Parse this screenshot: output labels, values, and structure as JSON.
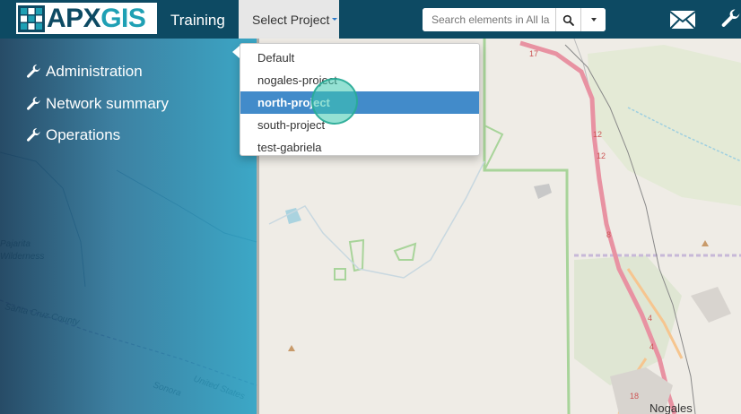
{
  "app": {
    "logo_text_apx": "APX",
    "logo_text_gis": "GIS",
    "brand_title": "Training"
  },
  "navbar": {
    "project_selector_label": "Select Project",
    "search_placeholder": "Search elements in All la",
    "icons": [
      "search-icon",
      "caret-down-icon",
      "mail-icon",
      "wrench-icon"
    ]
  },
  "sidebar": {
    "items": [
      {
        "label": "Administration",
        "icon": "wrench-icon"
      },
      {
        "label": "Network summary",
        "icon": "wrench-icon"
      },
      {
        "label": "Operations",
        "icon": "wrench-icon"
      }
    ]
  },
  "project_dropdown": {
    "options": [
      "Default",
      "nogales-project",
      "north-project",
      "south-project",
      "test-gabriela"
    ],
    "highlighted": "north-project"
  },
  "map": {
    "labels": [
      "Nogales",
      "Sonora",
      "United States",
      "Santa Cruz County",
      "Pajarita Wilderness"
    ],
    "route_shields": [
      "17",
      "12",
      "12",
      "8",
      "4",
      "4",
      "18"
    ]
  },
  "colors": {
    "navbar": "#0d4a63",
    "accent": "#1fa0b4",
    "dropdown_active": "#428bca",
    "sidebar_from": "#163e5c",
    "sidebar_to": "#28a0c3"
  }
}
